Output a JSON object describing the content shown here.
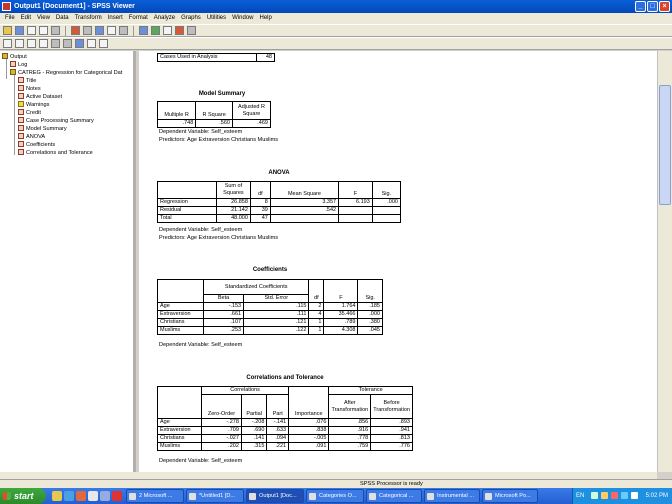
{
  "window": {
    "title": "Output1 [Document1] - SPSS Viewer"
  },
  "menu": [
    "File",
    "Edit",
    "View",
    "Data",
    "Transform",
    "Insert",
    "Format",
    "Analyze",
    "Graphs",
    "Utilities",
    "Window",
    "Help"
  ],
  "outline": {
    "items": [
      {
        "label": "Output",
        "level": 0,
        "icon": "book-icon"
      },
      {
        "label": "Log",
        "level": 1,
        "icon": "log-icon"
      },
      {
        "label": "CATREG - Regression for Categorical Dat",
        "level": 1,
        "icon": "book-icon"
      },
      {
        "label": "Title",
        "level": 2,
        "icon": "title-icon"
      },
      {
        "label": "Notes",
        "level": 2,
        "icon": "notes-icon"
      },
      {
        "label": "Active Dataset",
        "level": 2,
        "icon": "notes-icon"
      },
      {
        "label": "Warnings",
        "level": 2,
        "icon": "warning-icon"
      },
      {
        "label": "Credit",
        "level": 2,
        "icon": "notes-icon"
      },
      {
        "label": "Case Processing Summary",
        "level": 2,
        "icon": "table-icon"
      },
      {
        "label": "Model Summary",
        "level": 2,
        "icon": "table-icon"
      },
      {
        "label": "ANOVA",
        "level": 2,
        "icon": "table-icon"
      },
      {
        "label": "Coefficients",
        "level": 2,
        "icon": "table-icon"
      },
      {
        "label": "Correlations and Tolerance",
        "level": 2,
        "icon": "table-icon"
      }
    ]
  },
  "case_processing": {
    "label": "Cases Used in Analysis",
    "value": "48"
  },
  "model_summary": {
    "title": "Model Summary",
    "headers": [
      "Multiple R",
      "R Square",
      "Adjusted R Square"
    ],
    "values": [
      ".748",
      ".560",
      ".469"
    ],
    "note1": "Dependent Variable: Self_esteem",
    "note2": "Predictors: Age Extraversion Christians Muslims"
  },
  "anova": {
    "title": "ANOVA",
    "headers": [
      "",
      "Sum of Squares",
      "df",
      "Mean Square",
      "F",
      "Sig."
    ],
    "rows": [
      [
        "Regression",
        "26.858",
        "8",
        "3.357",
        "6.193",
        ".000"
      ],
      [
        "Residual",
        "21.142",
        "39",
        ".542",
        "",
        ""
      ],
      [
        "Total",
        "48.000",
        "47",
        "",
        "",
        ""
      ]
    ],
    "note1": "Dependent Variable: Self_esteem",
    "note2": "Predictors: Age Extraversion Christians Muslims"
  },
  "coefficients": {
    "title": "Coefficients",
    "group_header": "Standardized Coefficients",
    "headers": [
      "Beta",
      "Std. Error",
      "df",
      "F",
      "Sig."
    ],
    "rows": [
      [
        "Age",
        "-.153",
        ".115",
        "2",
        "1.764",
        ".185"
      ],
      [
        "Extraversion",
        ".661",
        ".111",
        "4",
        "35.466",
        ".000"
      ],
      [
        "Christians",
        ".107",
        ".121",
        "1",
        ".789",
        ".380"
      ],
      [
        "Muslims",
        ".253",
        ".122",
        "1",
        "4.308",
        ".045"
      ]
    ],
    "note": "Dependent Variable: Self_esteem"
  },
  "correlations": {
    "title": "Correlations and Tolerance",
    "group1": "Correlations",
    "group2": "Tolerance",
    "headers": [
      "Zero-Order",
      "Partial",
      "Part",
      "Importance",
      "After Transformation",
      "Before Transformation"
    ],
    "rows": [
      [
        "Age",
        "-.278",
        "-.208",
        "-.141",
        ".076",
        ".856",
        ".893"
      ],
      [
        "Extraversion",
        ".709",
        ".690",
        ".633",
        ".838",
        ".916",
        ".941"
      ],
      [
        "Christians",
        "-.027",
        ".141",
        ".094",
        "-.005",
        ".778",
        ".813"
      ],
      [
        "Muslims",
        ".202",
        ".315",
        ".221",
        ".091",
        ".759",
        ".776"
      ]
    ],
    "note": "Dependent Variable: Self_esteem"
  },
  "status": {
    "text": "SPSS Processor is ready"
  },
  "taskbar": {
    "start": "start",
    "tasks": [
      "2 Microsoft ...",
      "*Untitled1 [D...",
      "Output1 [Doc...",
      "Categories O...",
      "Categorical ...",
      "Instrumental ...",
      "Microsoft Po..."
    ],
    "lang": "EN",
    "clock": "5:02 PM"
  }
}
